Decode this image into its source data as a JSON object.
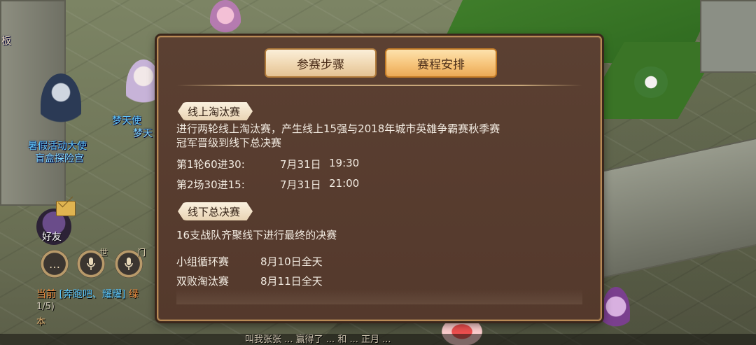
{
  "world": {
    "npcs": [
      {
        "label": "暑假活动大使",
        "sub": "盲盒探险宫"
      },
      {
        "label": "梦天使",
        "sub": "梦天"
      }
    ],
    "top_left_text": "板",
    "friends_label": "好友",
    "channel_tags": [
      "世",
      "门"
    ],
    "chat": {
      "channel": "当前",
      "line1_mid": "[奔跑吧、耀耀]",
      "line1_tail": "绿",
      "line2": "1/5)",
      "line3": "本"
    },
    "bottom_text": "叫我张张 ... 赢得了 ... 和 ... 正月 ..."
  },
  "dialog": {
    "tabs": [
      {
        "label": "参赛步骤",
        "active": false
      },
      {
        "label": "赛程安排",
        "active": true
      }
    ],
    "online": {
      "title": "线上淘汰赛",
      "desc": "进行两轮线上淘汰赛，产生线上15强与2018年城市英雄争霸赛秋季赛冠军晋级到线下总决赛",
      "rows": [
        {
          "round": "第1轮60进30:",
          "date": "7月31日",
          "time": "19:30"
        },
        {
          "round": "第2场30进15:",
          "date": "7月31日",
          "time": "21:00"
        }
      ]
    },
    "offline": {
      "title": "线下总决赛",
      "desc": "16支战队齐聚线下进行最终的决赛",
      "rows": [
        {
          "stage": "小组循环赛",
          "date": "8月10日全天"
        },
        {
          "stage": "双败淘汰赛",
          "date": "8月11日全天"
        }
      ]
    }
  },
  "colors": {
    "dialog_bg": "#573b2e",
    "dialog_border": "#b98a55",
    "tab_active": "#f6c47a",
    "tab_inactive": "#f0d7b1",
    "text": "#f3ece2"
  }
}
